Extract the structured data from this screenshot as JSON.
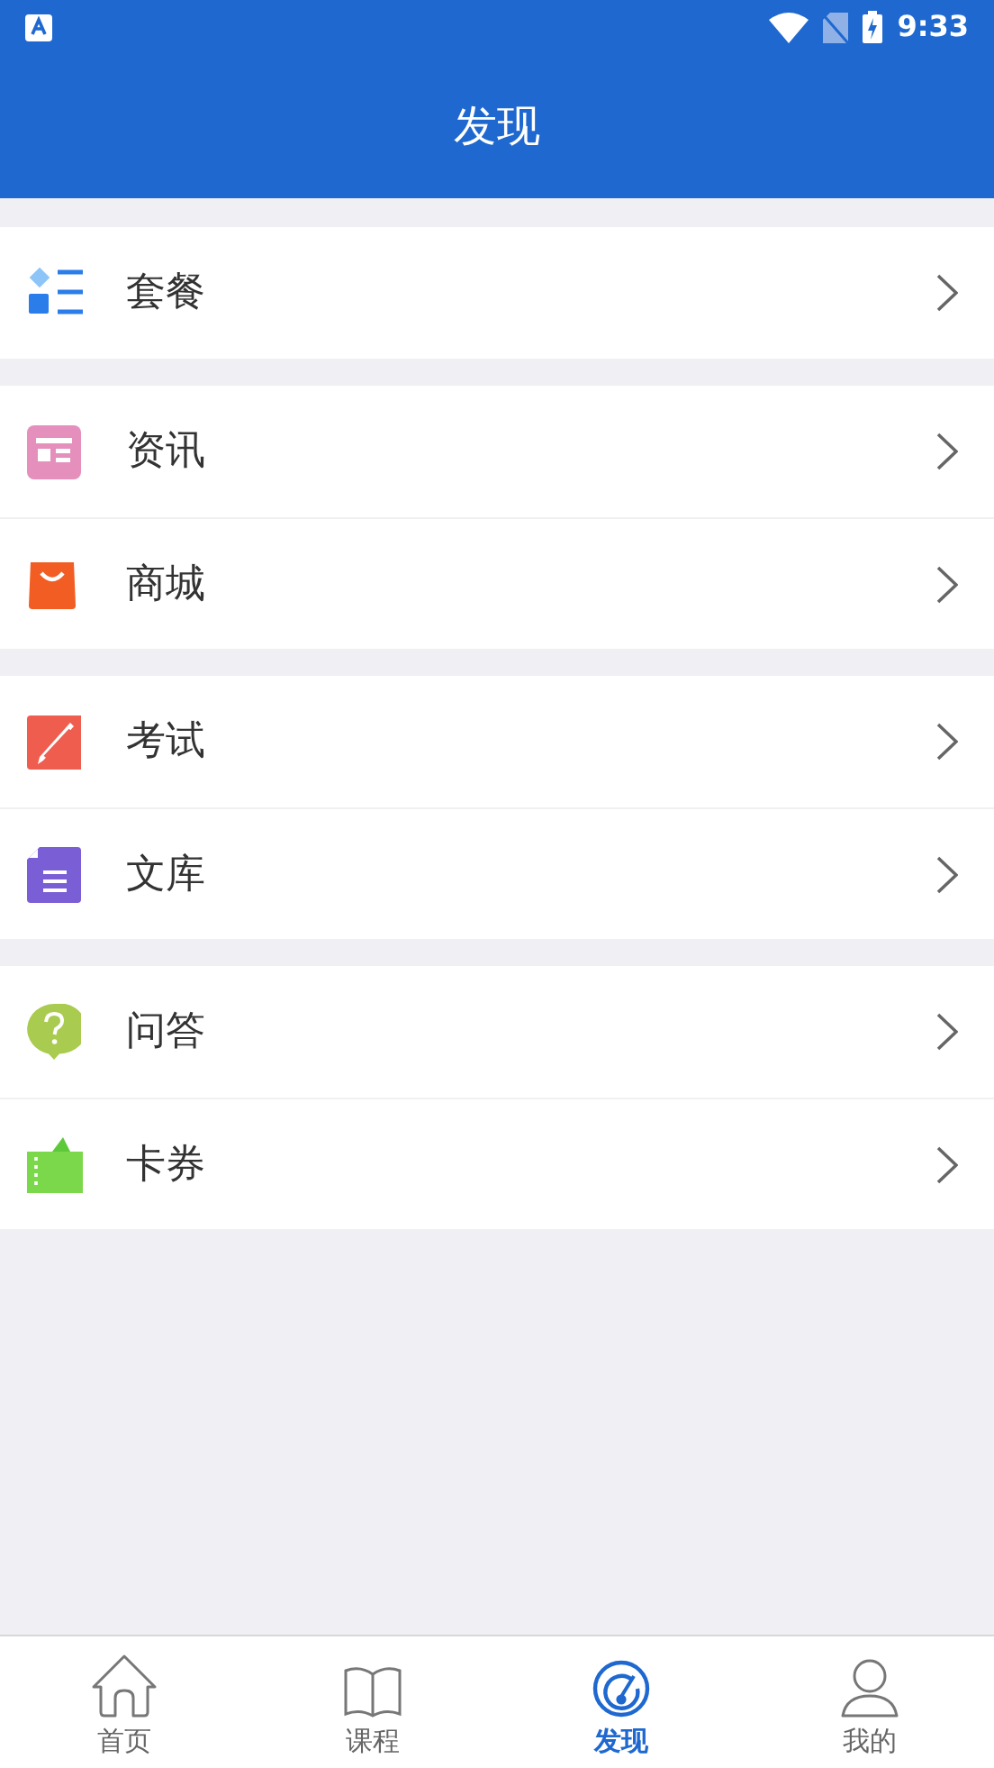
{
  "status_bar": {
    "time": "9:33"
  },
  "header": {
    "title": "发现"
  },
  "groups": [
    {
      "items": [
        {
          "label": "套餐"
        }
      ]
    },
    {
      "items": [
        {
          "label": "资讯"
        },
        {
          "label": "商城"
        }
      ]
    },
    {
      "items": [
        {
          "label": "考试"
        },
        {
          "label": "文库"
        }
      ]
    },
    {
      "items": [
        {
          "label": "问答"
        },
        {
          "label": "卡券"
        }
      ]
    }
  ],
  "tab_bar": [
    {
      "label": "首页",
      "selected": false
    },
    {
      "label": "课程",
      "selected": false
    },
    {
      "label": "发现",
      "selected": true
    },
    {
      "label": "我的",
      "selected": false
    }
  ]
}
